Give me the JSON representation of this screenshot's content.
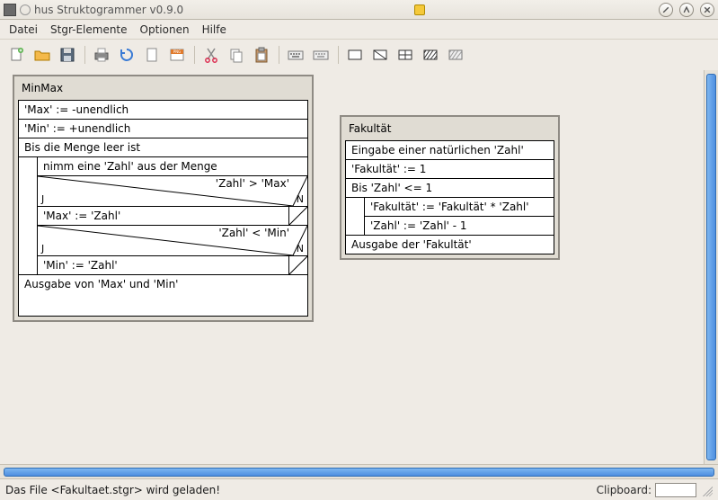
{
  "window": {
    "title": "hus Struktogrammer v0.9.0"
  },
  "menu": {
    "items": [
      "Datei",
      "Stgr-Elemente",
      "Optionen",
      "Hilfe"
    ]
  },
  "toolbar": {
    "icons": [
      "new-file",
      "open-file",
      "save-file",
      "print",
      "reload",
      "page",
      "export-png",
      "cut",
      "copy",
      "paste",
      "keyboard",
      "keyboard-alt",
      "block-simple",
      "block-diag",
      "block-grid",
      "block-hatch",
      "block-hatch2"
    ]
  },
  "diagrams": {
    "minmax": {
      "title": "MinMax",
      "init1": "'Max' := -unendlich",
      "init2": "'Min' := +unendlich",
      "loop_header": "Bis die Menge leer ist",
      "take": "nimm eine 'Zahl' aus der Menge",
      "cond1": "'Zahl' > 'Max'",
      "assign1": "'Max' := 'Zahl'",
      "cond2": "'Zahl' < 'Min'",
      "assign2": "'Min' := 'Zahl'",
      "j_label": "J",
      "n_label": "N",
      "output": "Ausgabe von 'Max' und 'Min'"
    },
    "fakultaet": {
      "title": "Fakultät",
      "input": "Eingabe einer natürlichen 'Zahl'",
      "init": "'Fakultät' := 1",
      "loop_header": "Bis 'Zahl' <= 1",
      "mul": "'Fakultät' := 'Fakultät' * 'Zahl'",
      "dec": "'Zahl' := 'Zahl' - 1",
      "output": "Ausgabe der 'Fakultät'"
    }
  },
  "status": {
    "message": "Das File <Fakultaet.stgr> wird geladen!",
    "clipboard_label": "Clipboard:"
  }
}
